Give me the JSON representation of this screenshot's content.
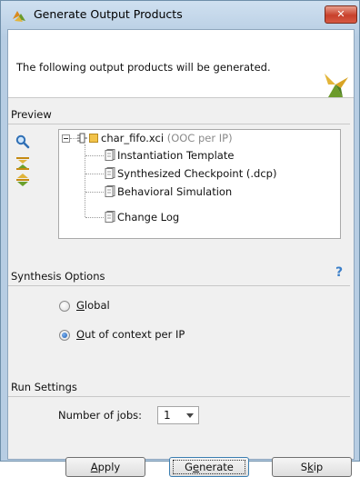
{
  "window": {
    "title": "Generate Output Products",
    "close_label": "✕"
  },
  "header": {
    "message": "The following output products will be generated."
  },
  "preview": {
    "section_title": "Preview",
    "tree": {
      "root": {
        "name": "char_fifo.xci",
        "suffix": "(OOC per IP)"
      },
      "children": [
        "Instantiation Template",
        "Synthesized Checkpoint (.dcp)",
        "Behavioral Simulation",
        "Change Log"
      ]
    }
  },
  "synthesis": {
    "section_title": "Synthesis Options",
    "options": [
      {
        "label_pre": "",
        "label_ul": "G",
        "label_post": "lobal",
        "selected": false
      },
      {
        "label_pre": "",
        "label_ul": "O",
        "label_post": "ut of context per IP",
        "selected": true
      }
    ],
    "help": "?"
  },
  "run_settings": {
    "section_title": "Run Settings",
    "jobs_label_pre": "Number of ",
    "jobs_label_ul": "j",
    "jobs_label_post": "obs:",
    "jobs_value": "1"
  },
  "buttons": {
    "apply": {
      "ul": "A",
      "rest": "pply"
    },
    "generate": {
      "pre": "G",
      "ul": "e",
      "rest": "nerate"
    },
    "skip": {
      "pre": "S",
      "ul": "k",
      "rest": "ip"
    }
  },
  "colors": {
    "accent": "#1c5fb4",
    "help": "#3b7fc9",
    "title_gradient": "#b7cde3"
  }
}
